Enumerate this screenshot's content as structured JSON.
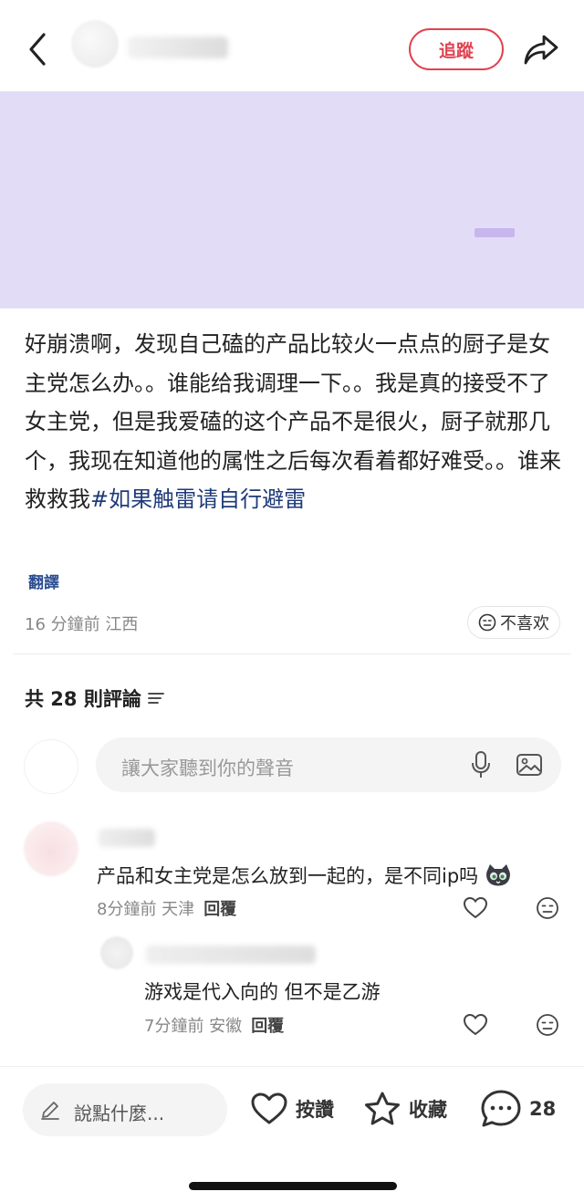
{
  "header": {
    "follow_label": "追蹤"
  },
  "post": {
    "body_text": "好崩溃啊，发现自己磕的产品比较火一点点的厨子是女主党怎么办。。谁能给我调理一下。。我是真的接受不了女主党，但是我爱磕的这个产品不是很火，厨子就那几个，我现在知道他的属性之后每次看着都好难受。。谁来救救我",
    "hashtag": "#如果触雷请自行避雷",
    "translate_label": "翻譯",
    "meta": "16 分鐘前 江西",
    "dislike_label": "不喜欢"
  },
  "comments_section": {
    "count_label": "共 28 則評論",
    "input_placeholder": "讓大家聽到你的聲音",
    "comments": [
      {
        "text": "产品和女主党是怎么放到一起的，是不同ip吗",
        "meta": "8分鐘前 天津",
        "reply_label": "回覆"
      },
      {
        "text": "游戏是代入向的 但不是乙游",
        "meta": "7分鐘前 安徽",
        "reply_label": "回覆"
      }
    ]
  },
  "bottom_bar": {
    "say_placeholder": "說點什麼...",
    "like_label": "按讚",
    "collect_label": "收藏",
    "comment_count": "28"
  },
  "colors": {
    "accent": "#e0424f",
    "banner_bg": "#e3dcf7",
    "hashtag": "#1f3a7a"
  },
  "icons": [
    "back-arrow-icon",
    "share-icon",
    "mic-icon",
    "image-icon",
    "heart-icon",
    "neutral-face-icon",
    "pen-icon",
    "star-icon",
    "comment-bubble-icon",
    "filter-icon",
    "cat-emoji-icon"
  ]
}
